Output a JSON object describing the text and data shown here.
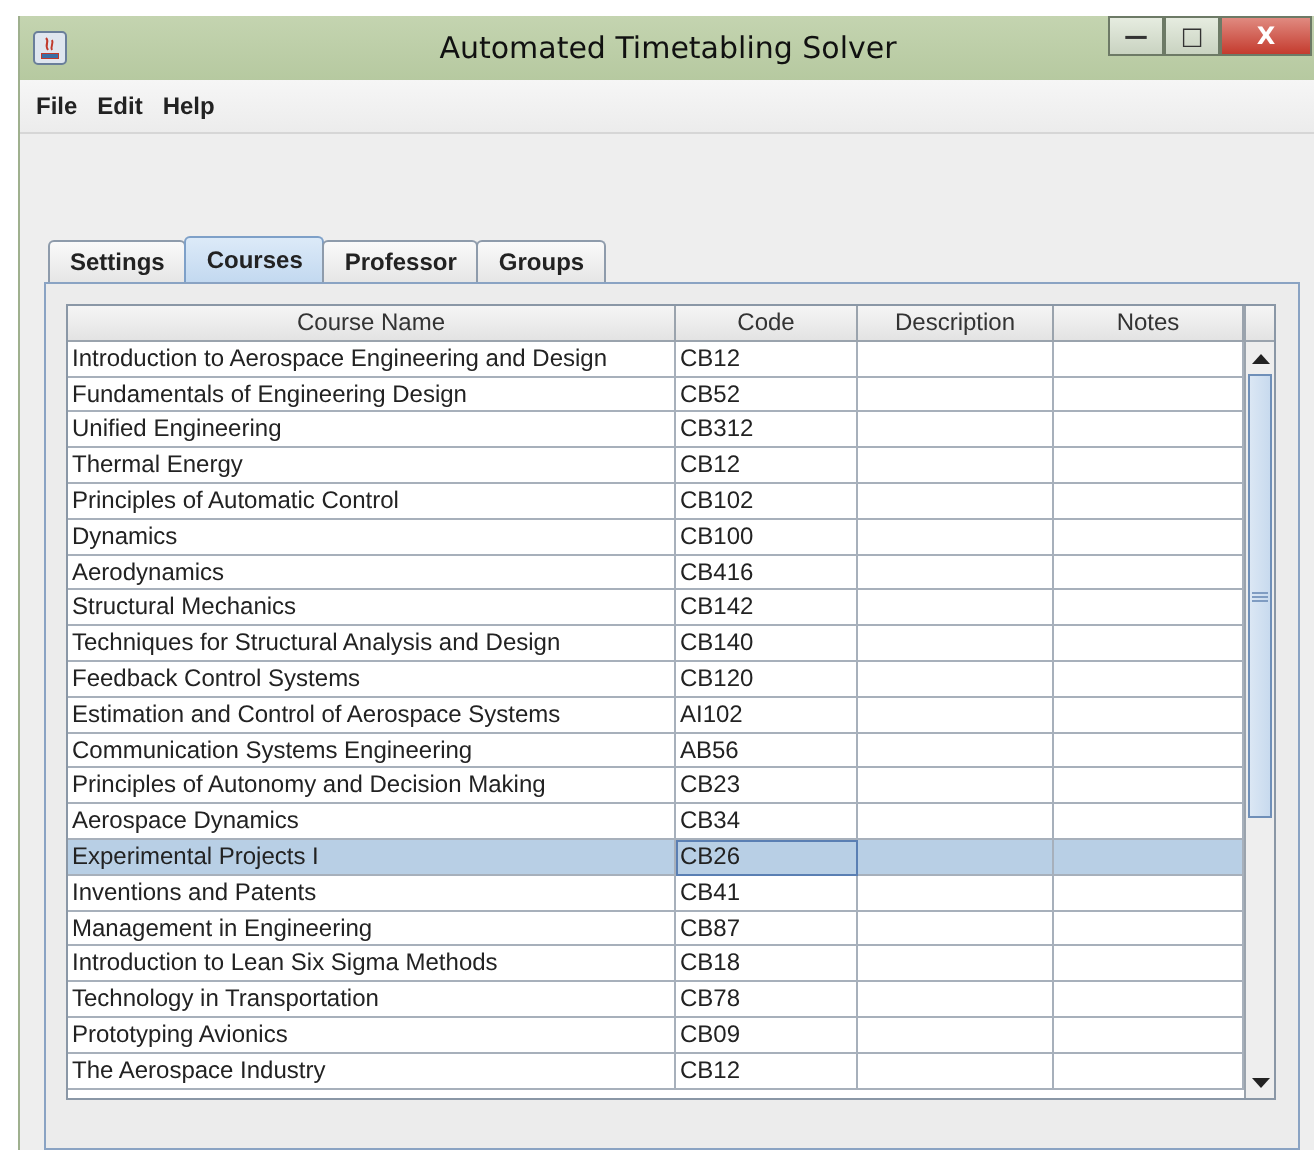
{
  "window": {
    "title": "Automated Timetabling Solver",
    "controls": [
      "—",
      "□",
      "X"
    ]
  },
  "menu": [
    "File",
    "Edit",
    "Help"
  ],
  "tabs": [
    {
      "label": "Settings",
      "selected": false
    },
    {
      "label": "Courses",
      "selected": true
    },
    {
      "label": "Professor",
      "selected": false
    },
    {
      "label": "Groups",
      "selected": false
    }
  ],
  "table": {
    "columns": [
      "Course Name",
      "Code",
      "Description",
      "Notes"
    ],
    "rows": [
      {
        "name": "Introduction to Aerospace Engineering and Design",
        "code": "CB12",
        "selected": false
      },
      {
        "name": "Fundamentals of Engineering Design",
        "code": "CB52",
        "selected": false
      },
      {
        "name": "Unified Engineering",
        "code": "CB312",
        "selected": false
      },
      {
        "name": "Thermal Energy",
        "code": "CB12",
        "selected": false
      },
      {
        "name": "Principles of Automatic Control",
        "code": "CB102",
        "selected": false
      },
      {
        "name": "Dynamics",
        "code": "CB100",
        "selected": false
      },
      {
        "name": "Aerodynamics",
        "code": "CB416",
        "selected": false
      },
      {
        "name": "Structural Mechanics",
        "code": "CB142",
        "selected": false
      },
      {
        "name": "Techniques for Structural Analysis and Design",
        "code": "CB140",
        "selected": false
      },
      {
        "name": "Feedback Control Systems",
        "code": "CB120",
        "selected": false
      },
      {
        "name": "Estimation and Control of Aerospace Systems",
        "code": "AI102",
        "selected": false
      },
      {
        "name": "Communication Systems Engineering",
        "code": "AB56",
        "selected": false
      },
      {
        "name": "Principles of Autonomy and Decision Making",
        "code": "CB23",
        "selected": false
      },
      {
        "name": "Aerospace Dynamics",
        "code": "CB34",
        "selected": false
      },
      {
        "name": "Experimental Projects I",
        "code": "CB26",
        "selected": true
      },
      {
        "name": "Inventions and Patents",
        "code": "CB41",
        "selected": false
      },
      {
        "name": "Management in Engineering",
        "code": "CB87",
        "selected": false
      },
      {
        "name": "Introduction to Lean Six Sigma Methods",
        "code": "CB18",
        "selected": false
      },
      {
        "name": "Technology in Transportation",
        "code": "CB78",
        "selected": false
      },
      {
        "name": "Prototyping Avionics",
        "code": "CB09",
        "selected": false
      },
      {
        "name": "The Aerospace Industry",
        "code": "CB12",
        "selected": false
      }
    ]
  }
}
